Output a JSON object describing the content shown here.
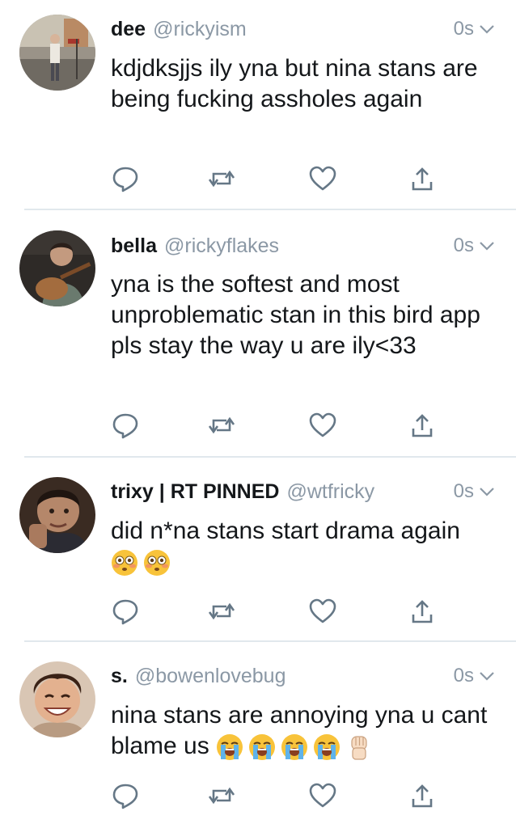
{
  "tweets": [
    {
      "name": "dee",
      "handle": "@rickyism",
      "time": "0s",
      "text": "kdjdksjjs ily yna but nina stans are being fucking assholes again"
    },
    {
      "name": "bella",
      "handle": "@rickyflakes",
      "time": "0s",
      "text": "yna is the softest and most unproblematic stan in this bird app pls stay the way u are ily<33"
    },
    {
      "name": "trixy | RT PINNED",
      "handle": "@wtfricky",
      "time": "0s",
      "text": "did n*na stans start drama again",
      "emojis": [
        "flushed-face",
        "flushed-face"
      ]
    },
    {
      "name": "s.",
      "handle": "@bowenlovebug",
      "time": "0s",
      "text": "nina stans are annoying yna u cant blame us",
      "emojis": [
        "loudly-crying-face",
        "loudly-crying-face",
        "loudly-crying-face",
        "loudly-crying-face",
        "raised-fist-light-skin-tone"
      ]
    }
  ],
  "icons": {
    "action_color": "#8899a6",
    "reply": "reply-icon",
    "retweet": "retweet-icon",
    "like": "like-icon",
    "share": "share-icon",
    "caret": "chevron-down-icon"
  }
}
